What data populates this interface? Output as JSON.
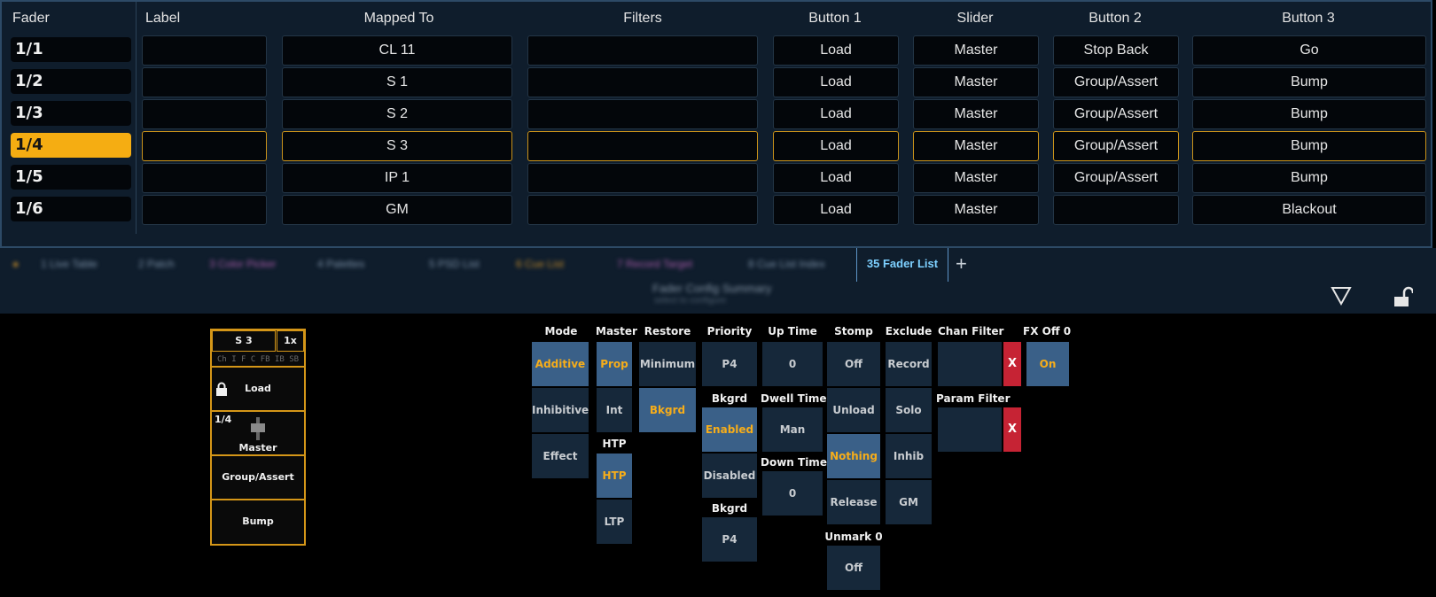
{
  "table": {
    "headers": {
      "fader": "Fader",
      "label": "Label",
      "mapped": "Mapped To",
      "filters": "Filters",
      "button1": "Button 1",
      "slider": "Slider",
      "button2": "Button 2",
      "button3": "Button 3"
    },
    "rows": [
      {
        "fader": "1/1",
        "label": "",
        "mapped": "CL 11",
        "filters": "",
        "button1": "Load",
        "slider": "Master",
        "button2": "Stop Back",
        "button3": "Go"
      },
      {
        "fader": "1/2",
        "label": "",
        "mapped": "S 1",
        "filters": "",
        "button1": "Load",
        "slider": "Master",
        "button2": "Group/Assert",
        "button3": "Bump"
      },
      {
        "fader": "1/3",
        "label": "",
        "mapped": "S 2",
        "filters": "",
        "button1": "Load",
        "slider": "Master",
        "button2": "Group/Assert",
        "button3": "Bump"
      },
      {
        "fader": "1/4",
        "label": "",
        "mapped": "S 3",
        "filters": "",
        "button1": "Load",
        "slider": "Master",
        "button2": "Group/Assert",
        "button3": "Bump"
      },
      {
        "fader": "1/5",
        "label": "",
        "mapped": "IP 1",
        "filters": "",
        "button1": "Load",
        "slider": "Master",
        "button2": "Group/Assert",
        "button3": "Bump"
      },
      {
        "fader": "1/6",
        "label": "",
        "mapped": "GM",
        "filters": "",
        "button1": "Load",
        "slider": "Master",
        "button2": "",
        "button3": "Blackout"
      }
    ],
    "selected_row": "1/4"
  },
  "tabs": {
    "blurred": [
      {
        "label": "1 Live Table"
      },
      {
        "label": "2 Patch"
      },
      {
        "label": "3 Color Picker"
      },
      {
        "label": "4 Palettes"
      },
      {
        "label": "5 PSD List"
      },
      {
        "label": "6 Cue List"
      },
      {
        "label": "7 Record Target"
      },
      {
        "label": "8 Cue List Index"
      }
    ],
    "active": "35 Fader List",
    "add": "+",
    "subtitle": "Fader Config Summary",
    "subtitle2": "select to configure"
  },
  "preview": {
    "target": "S 3",
    "rate": "1x",
    "icons": "Ch I F C FB IB SB",
    "button1": "Load",
    "fader_num": "1/4",
    "slider": "Master",
    "button2": "Group/Assert",
    "button3": "Bump"
  },
  "settings": {
    "mode": {
      "header": "Mode",
      "options": [
        "Additive",
        "Inhibitive",
        "Effect"
      ],
      "selected": "Additive"
    },
    "master": {
      "header": "Master",
      "options": [
        "Prop",
        "Int"
      ],
      "selected": "Prop"
    },
    "htp": {
      "header": "HTP",
      "options": [
        "HTP",
        "LTP"
      ],
      "selected": "HTP"
    },
    "restore": {
      "header": "Restore",
      "options": [
        "Minimum",
        "Bkgrd"
      ],
      "selected": "Bkgrd"
    },
    "priority": {
      "header": "Priority",
      "value": "P4"
    },
    "bkgrd_enabled": {
      "header": "Bkgrd",
      "options": [
        "Enabled",
        "Disabled"
      ],
      "selected": "Enabled"
    },
    "bkgrd_priority": {
      "header": "Bkgrd",
      "value": "P4"
    },
    "up_time": {
      "header": "Up Time",
      "value": "0"
    },
    "dwell_time": {
      "header": "Dwell Time",
      "value": "Man"
    },
    "down_time": {
      "header": "Down Time",
      "value": "0"
    },
    "stomp": {
      "header": "Stomp",
      "options": [
        "Off",
        "Unload",
        "Nothing",
        "Release"
      ],
      "selected": "Nothing"
    },
    "unmark": {
      "header": "Unmark 0",
      "value": "Off"
    },
    "exclude": {
      "header": "Exclude",
      "options": [
        "Record",
        "Solo",
        "Inhib",
        "GM"
      ]
    },
    "chan_filter": {
      "header": "Chan Filter",
      "clear": "X"
    },
    "param_filter": {
      "header": "Param Filter",
      "clear": "X"
    },
    "fx_off": {
      "header": "FX Off 0",
      "value": "On"
    }
  }
}
